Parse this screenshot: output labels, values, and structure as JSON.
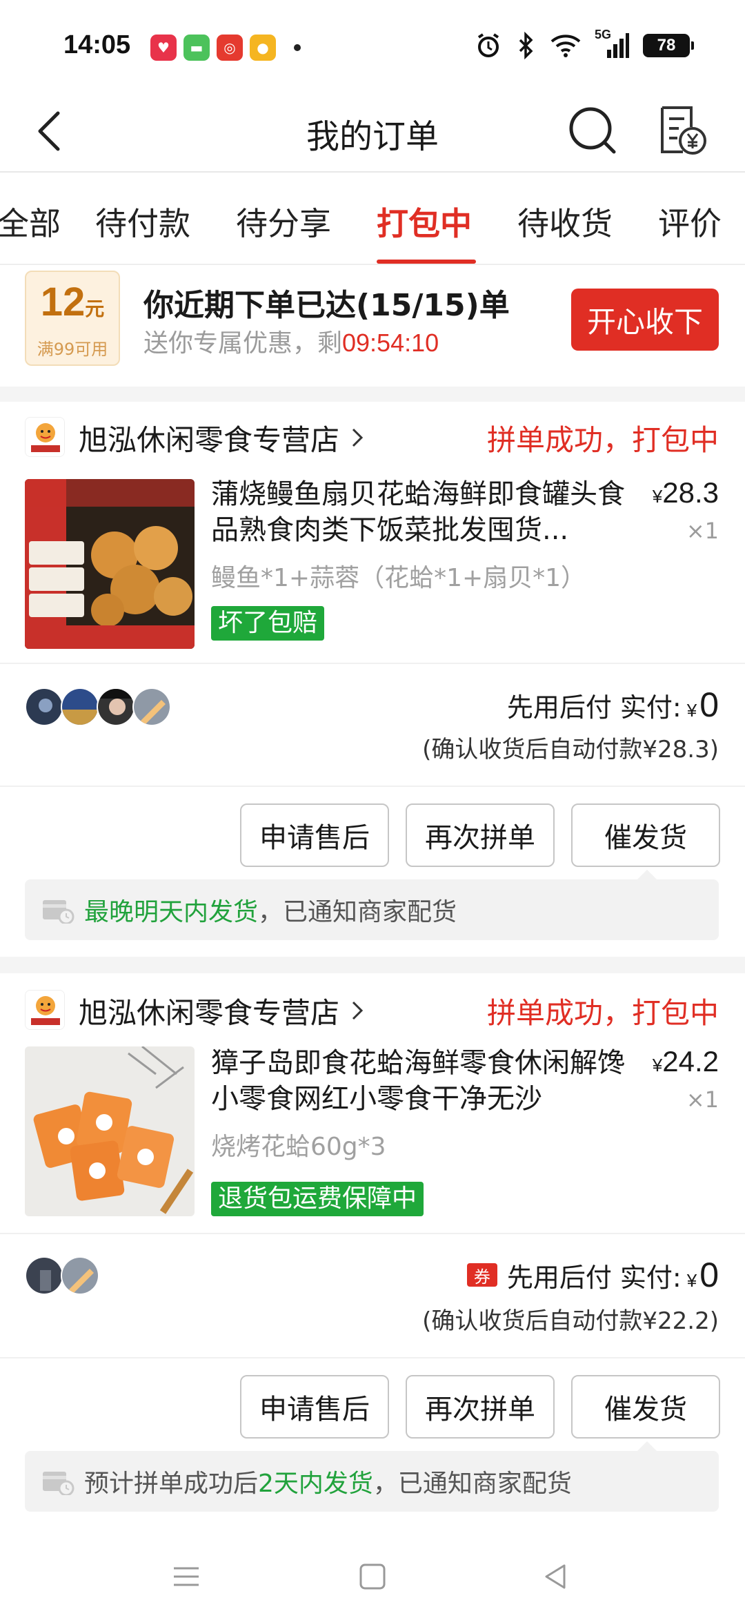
{
  "status_bar": {
    "time": "14:05",
    "network": "5G",
    "battery": "78",
    "app_icons": [
      "love-app-icon",
      "messages-icon",
      "weibo-red-icon",
      "weibo-icon"
    ]
  },
  "header": {
    "title": "我的订单"
  },
  "tabs": [
    {
      "label": "全部"
    },
    {
      "label": "待付款"
    },
    {
      "label": "待分享"
    },
    {
      "label": "打包中"
    },
    {
      "label": "待收货"
    },
    {
      "label": "评价"
    }
  ],
  "active_tab": "打包中",
  "coupon": {
    "amount": "12",
    "unit": "元",
    "condition": "满99可用",
    "headline": "你近期下单已达(15/15)单",
    "subtitle": "送你专属优惠，剩",
    "timer": "09:54:10",
    "button": "开心收下"
  },
  "orders": [
    {
      "shop_name": "旭泓休闲零食专营店",
      "status": "拼单成功，打包中",
      "product_title": "蒲烧鳗鱼扇贝花蛤海鲜即食罐头食品熟食肉类下饭菜批发囤货...",
      "price_symbol": "¥",
      "price": "28.3",
      "quantity": "×1",
      "spec": "鳗鱼*1+蒜蓉（花蛤*1+扇贝*1）",
      "tag": "坏了包赔",
      "pay_label": "先用后付 实付:",
      "pay_symbol": "¥",
      "pay_amount": "0",
      "pay_note": "(确认收货后自动付款¥28.3)",
      "buttons": [
        "申请售后",
        "再次拼单",
        "催发货"
      ],
      "notice_green": "最晚明天内发货",
      "notice_rest": "，已通知商家配货"
    },
    {
      "shop_name": "旭泓休闲零食专营店",
      "status": "拼单成功，打包中",
      "product_title": "獐子岛即食花蛤海鲜零食休闲解馋小零食网红小零食干净无沙",
      "price_symbol": "¥",
      "price": "24.2",
      "quantity": "×1",
      "spec": "烧烤花蛤60g*3",
      "tag": "退货包运费保障中",
      "coupon_chip": "券",
      "pay_label": "先用后付 实付:",
      "pay_symbol": "¥",
      "pay_amount": "0",
      "pay_note": "(确认收货后自动付款¥22.2)",
      "buttons": [
        "申请售后",
        "再次拼单",
        "催发货"
      ],
      "notice_prefix": "预计拼单成功后",
      "notice_green": "2天内发货",
      "notice_rest": "，已通知商家配货"
    }
  ],
  "colors": {
    "brand_red": "#e02e24",
    "green": "#1fa83a",
    "coupon_gold": "#c2700f"
  }
}
